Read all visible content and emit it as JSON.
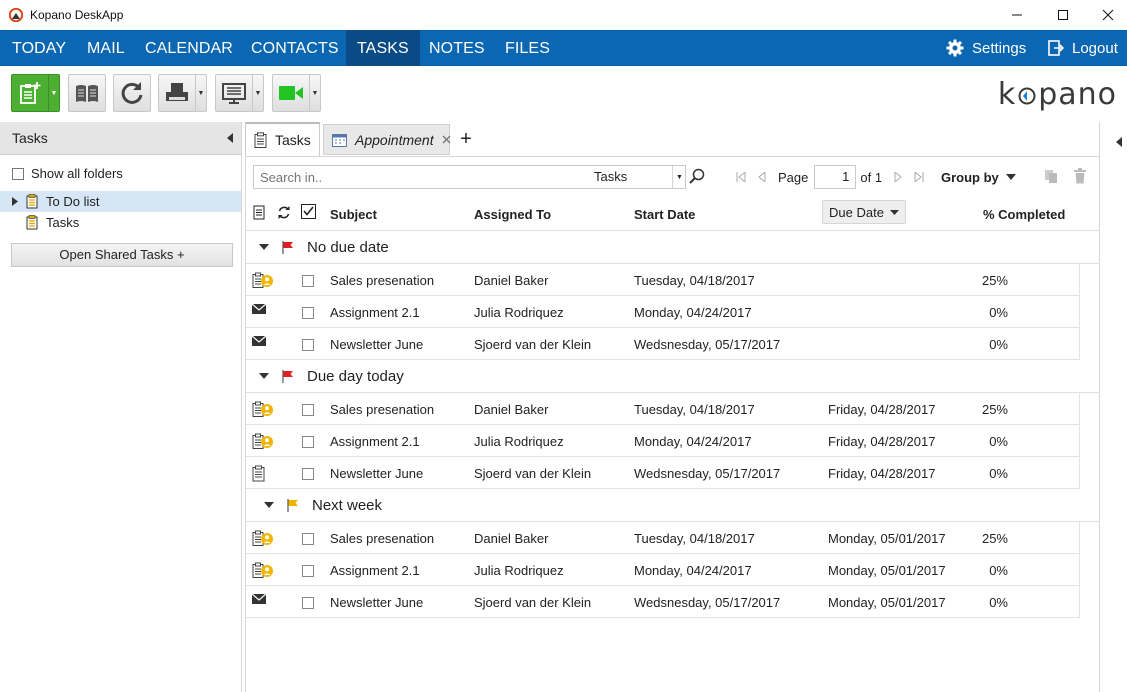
{
  "app": {
    "title": "Kopano DeskApp",
    "logo_text": "kopano"
  },
  "nav": {
    "items": [
      "TODAY",
      "MAIL",
      "CALENDAR",
      "CONTACTS",
      "TASKS",
      "NOTES",
      "FILES"
    ],
    "active": "TASKS",
    "settings_label": "Settings",
    "logout_label": "Logout"
  },
  "sidebar": {
    "title": "Tasks",
    "show_all_folders": "Show all folders",
    "tree": [
      "To Do list",
      "Tasks"
    ],
    "selected": "To Do list",
    "open_shared_button": "Open Shared Tasks +"
  },
  "tabs": {
    "items": [
      "Tasks",
      "Appointment"
    ],
    "active": "Tasks",
    "add_label": "+"
  },
  "search": {
    "placeholder": "Search in..",
    "scope": "Tasks"
  },
  "pager": {
    "page_label": "Page",
    "page_value": "1",
    "of_label": "of 1",
    "group_by_label": "Group by"
  },
  "columns": {
    "subject": "Subject",
    "assigned_to": "Assigned To",
    "start_date": "Start Date",
    "due_date": "Due Date",
    "percent_completed": "% Completed"
  },
  "groups": [
    {
      "label": "No due date",
      "flag_color": "#e02020",
      "rows": [
        {
          "icon": "task-request-icon",
          "subject": "Sales presenation",
          "assigned_to": "Daniel Baker",
          "start_date": "Tuesday, 04/18/2017",
          "due_date": "",
          "percent": "25%"
        },
        {
          "icon": "mail-icon",
          "subject": "Assignment 2.1",
          "assigned_to": "Julia Rodriquez",
          "start_date": "Monday, 04/24/2017",
          "due_date": "",
          "percent": "0%"
        },
        {
          "icon": "mail-icon",
          "subject": "Newsletter June",
          "assigned_to": "Sjoerd van der Klein",
          "start_date": "Wedsnesday, 05/17/2017",
          "due_date": "",
          "percent": "0%"
        }
      ]
    },
    {
      "label": "Due day today",
      "flag_color": "#e02020",
      "rows": [
        {
          "icon": "task-request-icon",
          "subject": "Sales presenation",
          "assigned_to": "Daniel Baker",
          "start_date": "Tuesday, 04/18/2017",
          "due_date": "Friday, 04/28/2017",
          "percent": "25%"
        },
        {
          "icon": "task-request-icon",
          "subject": "Assignment 2.1",
          "assigned_to": "Julia Rodriquez",
          "start_date": "Monday, 04/24/2017",
          "due_date": "Friday, 04/28/2017",
          "percent": "0%"
        },
        {
          "icon": "task-icon",
          "subject": "Newsletter June",
          "assigned_to": "Sjoerd van der Klein",
          "start_date": "Wedsnesday, 05/17/2017",
          "due_date": "Friday, 04/28/2017",
          "percent": "0%"
        }
      ]
    },
    {
      "label": "Next week",
      "flag_color": "#f0b400",
      "rows": [
        {
          "icon": "task-request-icon",
          "subject": "Sales presenation",
          "assigned_to": "Daniel Baker",
          "start_date": "Tuesday, 04/18/2017",
          "due_date": "Monday, 05/01/2017",
          "percent": "25%"
        },
        {
          "icon": "task-request-icon",
          "subject": "Assignment 2.1",
          "assigned_to": "Julia Rodriquez",
          "start_date": "Monday, 04/24/2017",
          "due_date": "Monday, 05/01/2017",
          "percent": "0%"
        },
        {
          "icon": "mail-icon",
          "subject": "Newsletter June",
          "assigned_to": "Sjoerd van der Klein",
          "start_date": "Wedsnesday, 05/17/2017",
          "due_date": "Monday, 05/01/2017",
          "percent": "0%"
        }
      ]
    }
  ],
  "colors": {
    "nav_bg": "#0b67b2",
    "nav_active": "#0a4a85",
    "new_button": "#4caf32",
    "video_icon": "#22c322"
  }
}
